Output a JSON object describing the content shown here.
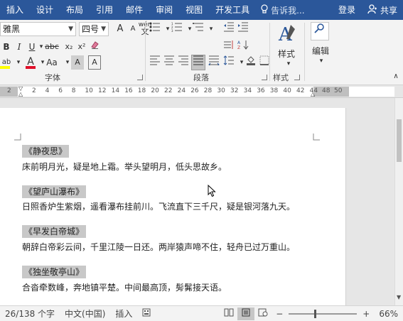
{
  "tabs": [
    "插入",
    "设计",
    "布局",
    "引用",
    "邮件",
    "审阅",
    "视图",
    "开发工具"
  ],
  "tell_me": "告诉我...",
  "login": "登录",
  "share": "共享",
  "font": {
    "name": "雅黑",
    "size": "四号",
    "big_a": "A",
    "small_a": "A",
    "bold": "B",
    "italic": "I",
    "underline": "U",
    "strike": "abc",
    "subscript": "x₂",
    "superscript": "x²",
    "highlight": "ab",
    "color": "A",
    "aa": "Aa",
    "wen": "wén",
    "wen_char": "文",
    "phonetic": "A",
    "border_char": "A",
    "group_label": "字体"
  },
  "paragraph": {
    "group_label": "段落"
  },
  "styles": {
    "label": "样式",
    "group_label": "样式"
  },
  "editing": {
    "label": "编辑"
  },
  "ruler": {
    "left_num": "2",
    "nums": [
      "2",
      "4",
      "6",
      "8",
      "10",
      "12",
      "14",
      "16",
      "18",
      "20",
      "22",
      "24",
      "26",
      "28",
      "30",
      "32",
      "34",
      "36",
      "38",
      "40",
      "42",
      "44"
    ],
    "right_nums": [
      "48",
      "50"
    ]
  },
  "poems": [
    {
      "title": "《静夜思》",
      "body": "床前明月光，疑是地上霜。举头望明月，低头思故乡。"
    },
    {
      "title": "《望庐山瀑布》",
      "body": "日照香炉生紫烟，遥看瀑布挂前川。飞流直下三千尺，疑是银河落九天。"
    },
    {
      "title": "《早发白帝城》",
      "body": "朝辞白帝彩云间，千里江陵一日还。两岸猿声啼不住，轻舟已过万重山。"
    },
    {
      "title": "《独坐敬亭山》",
      "body": "合沓牵数峰，奔地镇平楚。中间最高顶，髣髴接天语。"
    }
  ],
  "status": {
    "words": "26/138 个字",
    "lang": "中文(中国)",
    "mode": "插入",
    "zoom": "66%",
    "zoom_minus": "−",
    "zoom_plus": "+"
  },
  "colors": {
    "accent": "#2b579a",
    "highlight": "#ffff00",
    "font_color": "#e0102a"
  }
}
